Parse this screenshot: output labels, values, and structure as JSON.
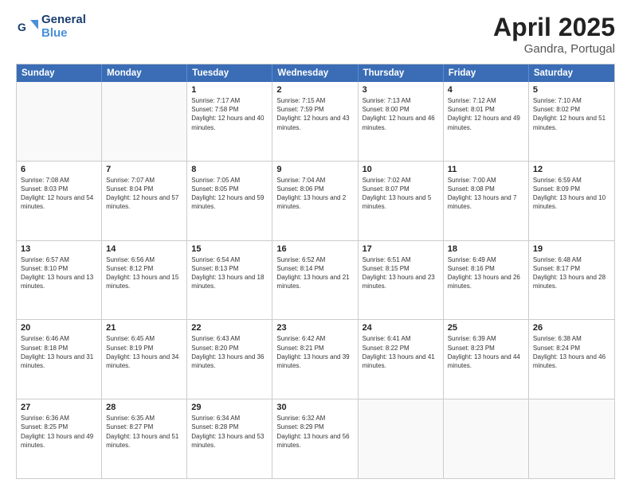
{
  "header": {
    "logo_line1": "General",
    "logo_line2": "Blue",
    "month": "April 2025",
    "location": "Gandra, Portugal"
  },
  "days_of_week": [
    "Sunday",
    "Monday",
    "Tuesday",
    "Wednesday",
    "Thursday",
    "Friday",
    "Saturday"
  ],
  "rows": [
    [
      {
        "day": "",
        "info": ""
      },
      {
        "day": "",
        "info": ""
      },
      {
        "day": "1",
        "info": "Sunrise: 7:17 AM\nSunset: 7:58 PM\nDaylight: 12 hours and 40 minutes."
      },
      {
        "day": "2",
        "info": "Sunrise: 7:15 AM\nSunset: 7:59 PM\nDaylight: 12 hours and 43 minutes."
      },
      {
        "day": "3",
        "info": "Sunrise: 7:13 AM\nSunset: 8:00 PM\nDaylight: 12 hours and 46 minutes."
      },
      {
        "day": "4",
        "info": "Sunrise: 7:12 AM\nSunset: 8:01 PM\nDaylight: 12 hours and 49 minutes."
      },
      {
        "day": "5",
        "info": "Sunrise: 7:10 AM\nSunset: 8:02 PM\nDaylight: 12 hours and 51 minutes."
      }
    ],
    [
      {
        "day": "6",
        "info": "Sunrise: 7:08 AM\nSunset: 8:03 PM\nDaylight: 12 hours and 54 minutes."
      },
      {
        "day": "7",
        "info": "Sunrise: 7:07 AM\nSunset: 8:04 PM\nDaylight: 12 hours and 57 minutes."
      },
      {
        "day": "8",
        "info": "Sunrise: 7:05 AM\nSunset: 8:05 PM\nDaylight: 12 hours and 59 minutes."
      },
      {
        "day": "9",
        "info": "Sunrise: 7:04 AM\nSunset: 8:06 PM\nDaylight: 13 hours and 2 minutes."
      },
      {
        "day": "10",
        "info": "Sunrise: 7:02 AM\nSunset: 8:07 PM\nDaylight: 13 hours and 5 minutes."
      },
      {
        "day": "11",
        "info": "Sunrise: 7:00 AM\nSunset: 8:08 PM\nDaylight: 13 hours and 7 minutes."
      },
      {
        "day": "12",
        "info": "Sunrise: 6:59 AM\nSunset: 8:09 PM\nDaylight: 13 hours and 10 minutes."
      }
    ],
    [
      {
        "day": "13",
        "info": "Sunrise: 6:57 AM\nSunset: 8:10 PM\nDaylight: 13 hours and 13 minutes."
      },
      {
        "day": "14",
        "info": "Sunrise: 6:56 AM\nSunset: 8:12 PM\nDaylight: 13 hours and 15 minutes."
      },
      {
        "day": "15",
        "info": "Sunrise: 6:54 AM\nSunset: 8:13 PM\nDaylight: 13 hours and 18 minutes."
      },
      {
        "day": "16",
        "info": "Sunrise: 6:52 AM\nSunset: 8:14 PM\nDaylight: 13 hours and 21 minutes."
      },
      {
        "day": "17",
        "info": "Sunrise: 6:51 AM\nSunset: 8:15 PM\nDaylight: 13 hours and 23 minutes."
      },
      {
        "day": "18",
        "info": "Sunrise: 6:49 AM\nSunset: 8:16 PM\nDaylight: 13 hours and 26 minutes."
      },
      {
        "day": "19",
        "info": "Sunrise: 6:48 AM\nSunset: 8:17 PM\nDaylight: 13 hours and 28 minutes."
      }
    ],
    [
      {
        "day": "20",
        "info": "Sunrise: 6:46 AM\nSunset: 8:18 PM\nDaylight: 13 hours and 31 minutes."
      },
      {
        "day": "21",
        "info": "Sunrise: 6:45 AM\nSunset: 8:19 PM\nDaylight: 13 hours and 34 minutes."
      },
      {
        "day": "22",
        "info": "Sunrise: 6:43 AM\nSunset: 8:20 PM\nDaylight: 13 hours and 36 minutes."
      },
      {
        "day": "23",
        "info": "Sunrise: 6:42 AM\nSunset: 8:21 PM\nDaylight: 13 hours and 39 minutes."
      },
      {
        "day": "24",
        "info": "Sunrise: 6:41 AM\nSunset: 8:22 PM\nDaylight: 13 hours and 41 minutes."
      },
      {
        "day": "25",
        "info": "Sunrise: 6:39 AM\nSunset: 8:23 PM\nDaylight: 13 hours and 44 minutes."
      },
      {
        "day": "26",
        "info": "Sunrise: 6:38 AM\nSunset: 8:24 PM\nDaylight: 13 hours and 46 minutes."
      }
    ],
    [
      {
        "day": "27",
        "info": "Sunrise: 6:36 AM\nSunset: 8:25 PM\nDaylight: 13 hours and 49 minutes."
      },
      {
        "day": "28",
        "info": "Sunrise: 6:35 AM\nSunset: 8:27 PM\nDaylight: 13 hours and 51 minutes."
      },
      {
        "day": "29",
        "info": "Sunrise: 6:34 AM\nSunset: 8:28 PM\nDaylight: 13 hours and 53 minutes."
      },
      {
        "day": "30",
        "info": "Sunrise: 6:32 AM\nSunset: 8:29 PM\nDaylight: 13 hours and 56 minutes."
      },
      {
        "day": "",
        "info": ""
      },
      {
        "day": "",
        "info": ""
      },
      {
        "day": "",
        "info": ""
      }
    ]
  ]
}
